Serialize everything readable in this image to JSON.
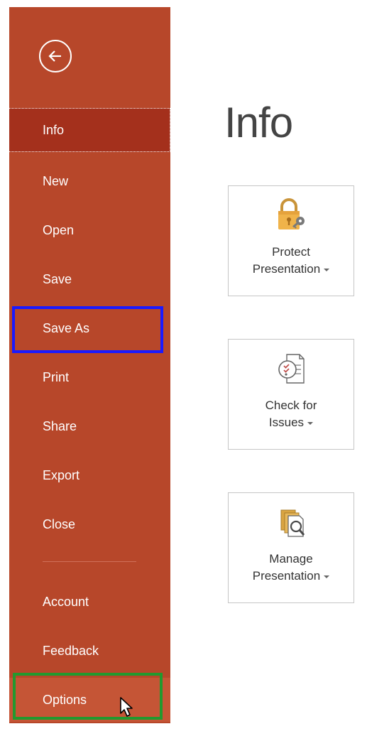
{
  "sidebar": {
    "back_icon": "back-arrow-icon",
    "items": [
      {
        "label": "Info",
        "state": "selected"
      },
      {
        "label": "New"
      },
      {
        "label": "Open"
      },
      {
        "label": "Save"
      },
      {
        "label": "Save As",
        "highlight": "blue"
      },
      {
        "label": "Print"
      },
      {
        "label": "Share"
      },
      {
        "label": "Export"
      },
      {
        "label": "Close"
      },
      {
        "label": "Account"
      },
      {
        "label": "Feedback"
      },
      {
        "label": "Options",
        "state": "hovered",
        "highlight": "green"
      }
    ]
  },
  "main": {
    "title": "Info",
    "tiles": [
      {
        "line1": "Protect",
        "line2": "Presentation",
        "icon": "lock-key-icon",
        "has_dropdown": true
      },
      {
        "line1": "Check for",
        "line2": "Issues",
        "icon": "checklist-icon",
        "has_dropdown": true
      },
      {
        "line1": "Manage",
        "line2": "Presentation",
        "icon": "manage-documents-icon",
        "has_dropdown": true
      }
    ]
  },
  "colors": {
    "sidebar_bg": "#b7472a",
    "selected_bg": "#a4301c",
    "hover_bg": "#c55536",
    "highlight_blue": "#1a1aff",
    "highlight_green": "#22992e"
  }
}
